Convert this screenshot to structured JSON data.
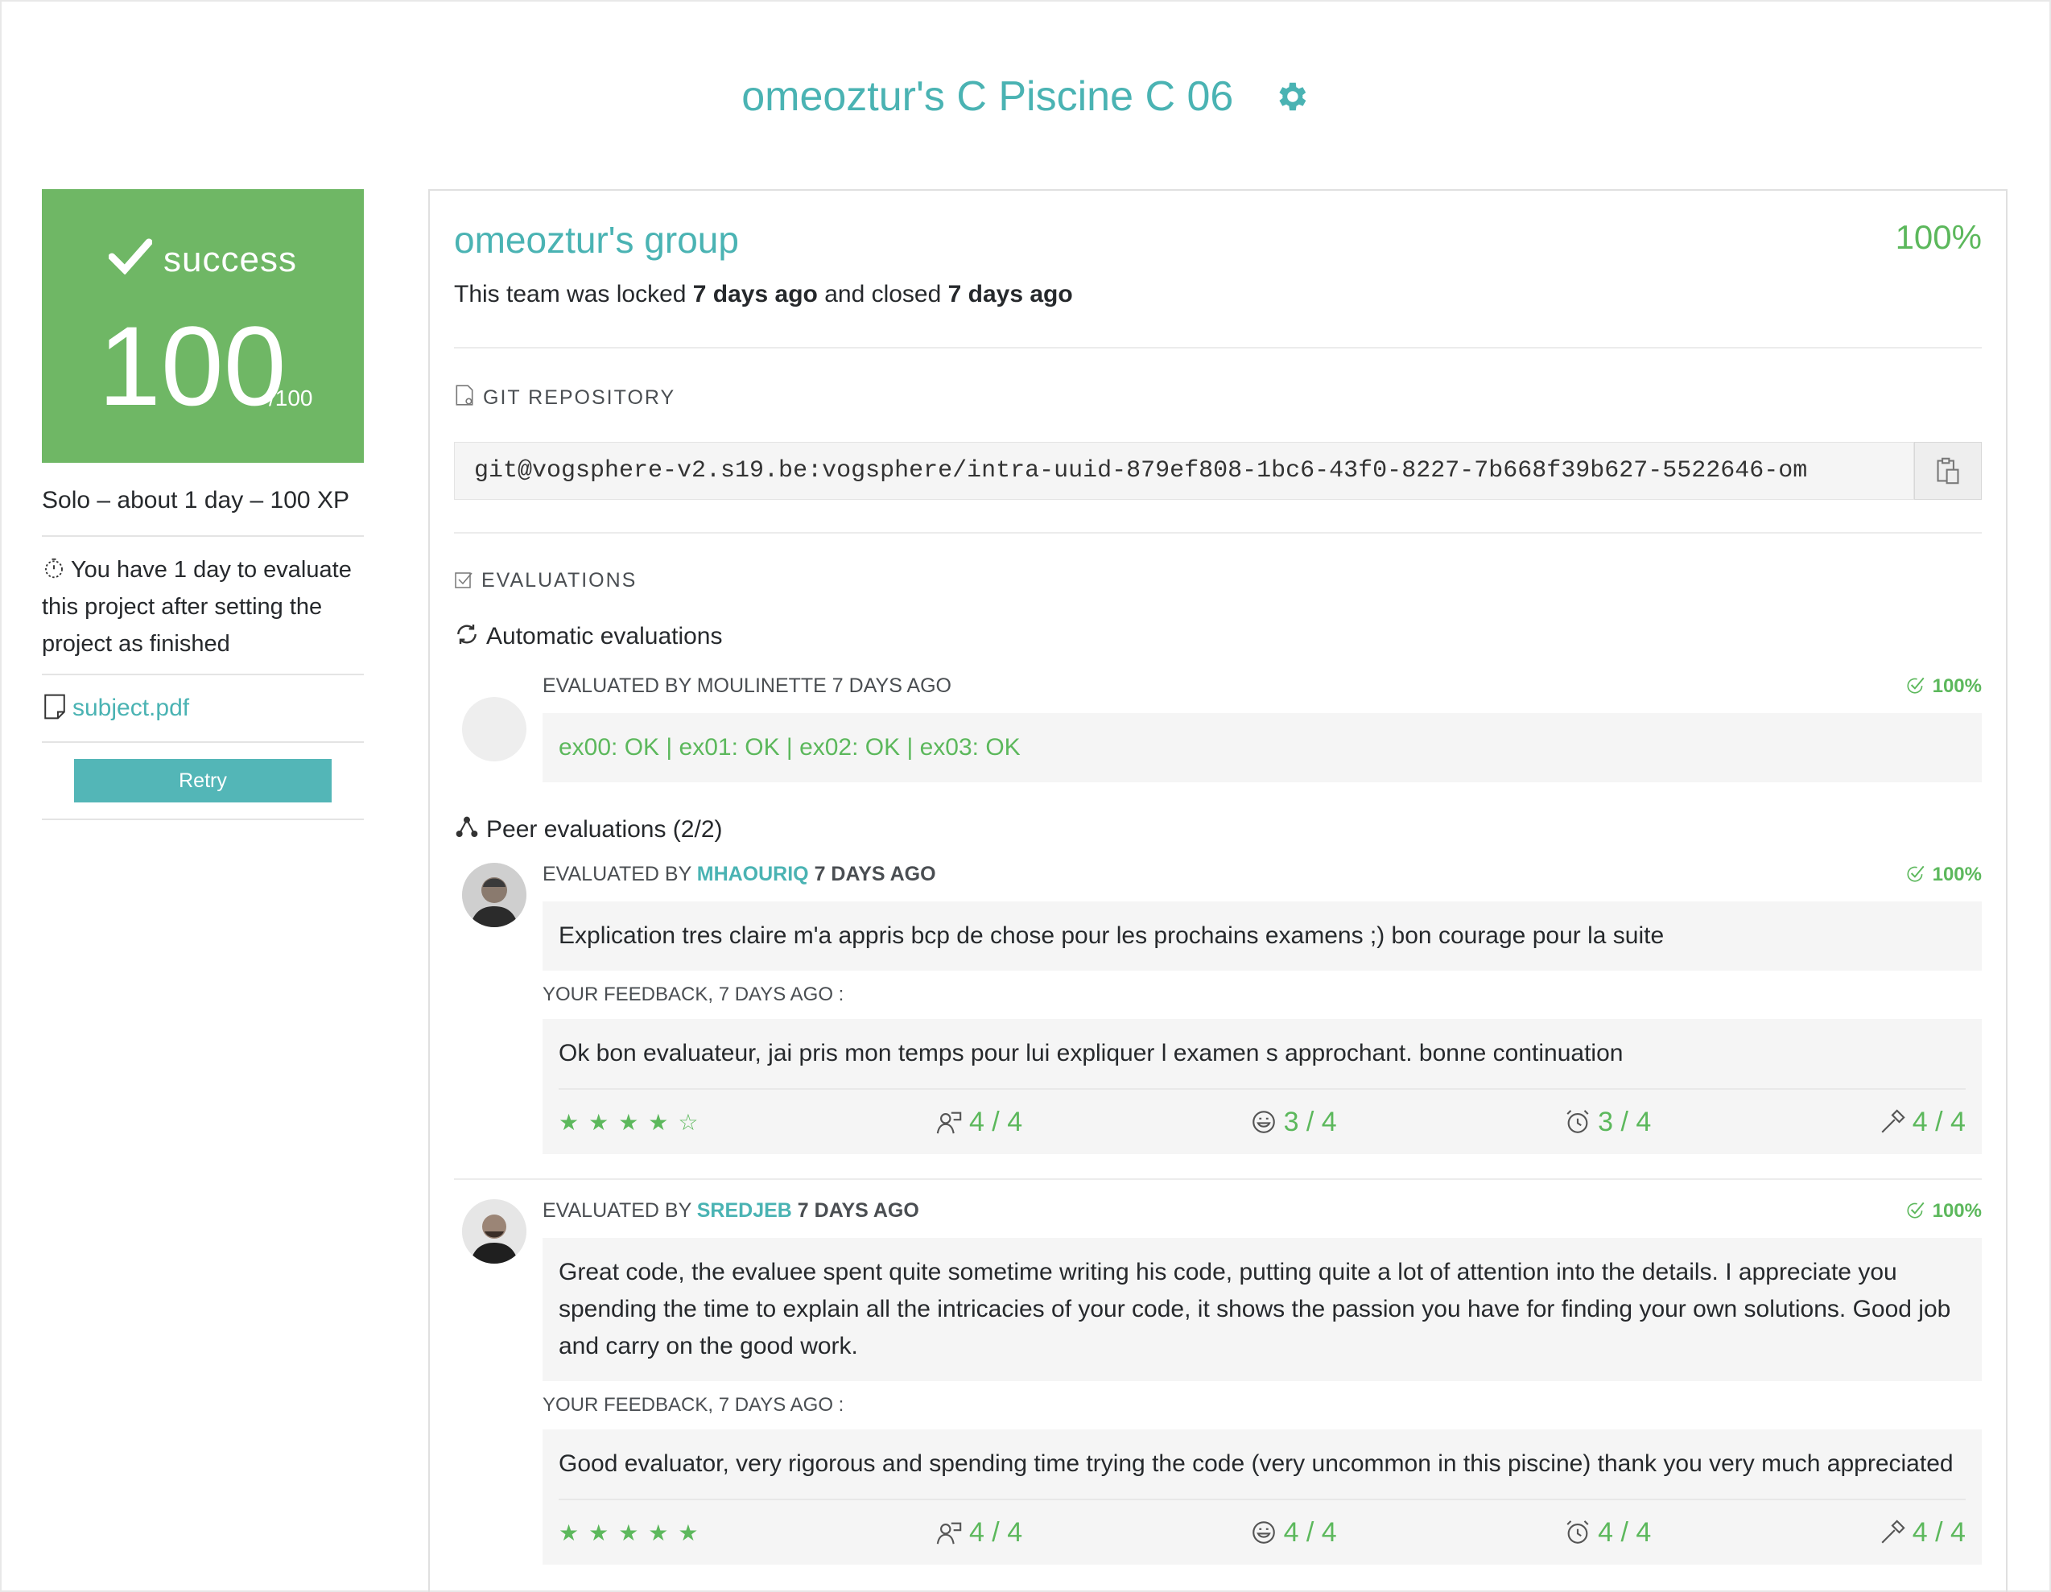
{
  "header": {
    "title": "omeoztur's C Piscine C 06"
  },
  "left": {
    "status": "success",
    "score": "100",
    "score_max": "/100",
    "meta": "Solo – about 1 day – 100 XP",
    "timer_text": "You have 1 day to evaluate this project after setting the project as finished",
    "subject_link": "subject.pdf",
    "retry_label": "Retry"
  },
  "group": {
    "name": "omeoztur's group",
    "percent": "100%",
    "lock_prefix": "This team was locked ",
    "locked_ago": "7 days ago",
    "lock_middle": " and closed ",
    "closed_ago": "7 days ago"
  },
  "git": {
    "label": "GIT REPOSITORY",
    "url": "git@vogsphere-v2.s19.be:vogsphere/intra-uuid-879ef808-1bc6-43f0-8227-7b668f39b627-5522646-om"
  },
  "evaluations": {
    "label": "EVALUATIONS",
    "auto_heading": "Automatic evaluations",
    "auto": {
      "by": "EVALUATED BY MOULINETTE 7 DAYS AGO",
      "grade": "100%",
      "text": "ex00: OK | ex01: OK | ex02: OK | ex03: OK"
    },
    "peer_heading": "Peer evaluations (2/2)",
    "peers": [
      {
        "prefix": "EVALUATED BY ",
        "login": "MHAOURIQ",
        "ago": " 7 DAYS AGO",
        "grade": "100%",
        "comment": "Explication tres claire m'a appris bcp de chose pour les prochains examens ;) bon courage pour la suite",
        "feedback_label": "YOUR FEEDBACK, 7 DAYS AGO :",
        "feedback": "Ok bon evaluateur, jai pris mon temps pour lui expliquer l examen s approchant. bonne continuation",
        "stars": "★★★★☆",
        "stars_value": 4,
        "ratings": [
          "4 / 4",
          "3 / 4",
          "3 / 4",
          "4 / 4"
        ]
      },
      {
        "prefix": "EVALUATED BY ",
        "login": "SREDJEB",
        "ago": " 7 DAYS AGO",
        "grade": "100%",
        "comment": "Great code, the evaluee spent quite sometime writing his code, putting quite a lot of attention into the details. I appreciate you spending the time to explain all the intricacies of your code, it shows the passion you have for finding your own solutions. Good job and carry on the good work.",
        "feedback_label": "YOUR FEEDBACK, 7 DAYS AGO :",
        "feedback": "Good evaluator, very rigorous and spending time trying the code (very uncommon in this piscine) thank you very much appreciated",
        "stars": "★★★★★",
        "stars_value": 5,
        "ratings": [
          "4 / 4",
          "4 / 4",
          "4 / 4",
          "4 / 4"
        ]
      }
    ]
  },
  "colors": {
    "accent": "#4ab3b3",
    "success": "#6fb765",
    "ok_green": "#5cb85c"
  }
}
